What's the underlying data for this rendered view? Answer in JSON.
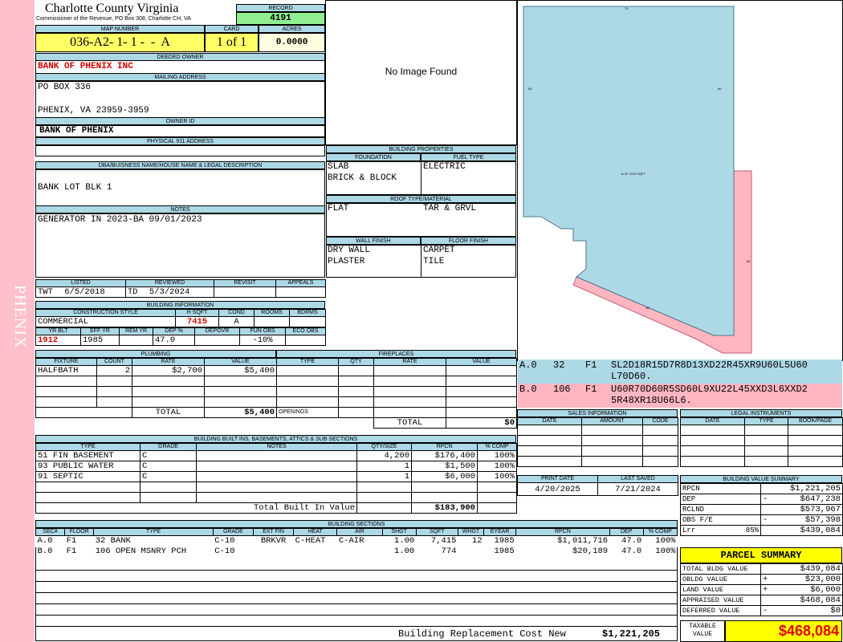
{
  "sidebar": {
    "label": "PHENIX",
    "color": "#ffc0cb"
  },
  "header": {
    "county": "Charlotte County Virginia",
    "commissioner": "Commissioner of the Revenue, PO Box 308, Charlotte CH, VA"
  },
  "record": {
    "label": "RECORD",
    "value": "4191"
  },
  "map_number": {
    "label": "MAP NUMBER",
    "value": "036-A2- 1- 1 -  -  A"
  },
  "card": {
    "label": "CARD",
    "value": "1 of 1"
  },
  "acres": {
    "label": "ACRES",
    "value": "0.0000"
  },
  "deeded_owner": {
    "label": "DEEDED OWNER",
    "value": "BANK OF PHENIX INC"
  },
  "mailing": {
    "label": "MAILING ADDRESS",
    "line1": "PO BOX 336",
    "line2": "PHENIX, VA 23959-3959"
  },
  "owner_id": {
    "label": "OWNER ID",
    "value": "BANK OF PHENIX"
  },
  "physical": {
    "label": "PHYSICAL 911 ADDRESS",
    "value": ""
  },
  "dba": {
    "label": "DBA/BUISNESS NAME/HOUSE NAME & LEGAL DESCRIPTION",
    "value": "BANK LOT BLK 1"
  },
  "notes": {
    "label": "NOTES",
    "value": "GENERATOR IN 2023-BA 09/01/2023"
  },
  "photo": {
    "text": "No Image Found"
  },
  "building_properties": {
    "label": "BUILDING PROPERTIES",
    "foundation_label": "FOUNDATION",
    "fuel_label": "FUEL TYPE",
    "foundation1": "SLAB",
    "foundation2": "BRICK & BLOCK",
    "fuel": "ELECTRIC",
    "roof_label": "ROOF TYPE/MATERIAL",
    "roof_type": "FLAT",
    "roof_material": "TAR & GRVL",
    "wall_label": "WALL FINISH",
    "floor_label": "FLOOR FINISH",
    "wall1": "DRY WALL",
    "wall2": "PLASTER",
    "floor1": "CARPET",
    "floor2": "TILE"
  },
  "review": {
    "listed_label": "LISTED",
    "reviewed_label": "REVIEWED",
    "revisit_label": "REVISIT",
    "appeals_label": "APPEALS",
    "listed_by": "TWT",
    "listed_date": "6/5/2018",
    "reviewed_by": "TD",
    "reviewed_date": "5/3/2024"
  },
  "building_info": {
    "label": "BUILDING INFORMATION",
    "style_label": "CONSTRUCTION STYLE",
    "hsqft_label": "H SQFT",
    "cond_label": "COND",
    "rooms_label": "ROOMS",
    "bdrms_label": "BDRMS",
    "style": "COMMERCIAL",
    "hsqft": "7415",
    "cond": "A",
    "yrblt_label": "YR BLT",
    "effyr_label": "EFF YR",
    "remyr_label": "REM YR",
    "dep_label": "DEP %",
    "depovr_label": "DEPOVR",
    "funobs_label": "FUN OBS",
    "ecoobs_label": "ECO OBS",
    "yrblt": "1912",
    "effyr": "1985",
    "dep": "47.0",
    "funobs": "-10%"
  },
  "plumbing": {
    "label": "PLUMBING",
    "cols": [
      "FIXTURE",
      "COUNT",
      "RATE",
      "VALUE"
    ],
    "rows": [
      [
        "HALFBATH",
        "2",
        "$2,700",
        "$5,400"
      ]
    ],
    "total_label": "TOTAL",
    "total": "$5,400"
  },
  "fireplaces": {
    "label": "FIREPLACES",
    "cols": [
      "TYPE",
      "QTY",
      "RATE",
      "VALUE"
    ],
    "openings_label": "OPENINGS",
    "total_label": "TOTAL",
    "total": "$0"
  },
  "sketch_legend": [
    {
      "code": "A.0",
      "num": "32",
      "floor": "F1",
      "line1": "SL2D18R15D7R8D13XD22R45XR9U60L5U60",
      "line2": "L70D60.",
      "color": "#add8e6"
    },
    {
      "code": "B.0",
      "num": "106",
      "floor": "F1",
      "line1": "U60R70D60R5SD60L9XU22L45XXD3L6XXD2",
      "line2": "5R48XR18U66L6.",
      "color": "#ffb6c1"
    }
  ],
  "sketch_labels": {
    "top": "70",
    "left": "60",
    "right": "60",
    "area": "A 32\n7415 SQFT",
    "b_right": "60",
    "b_bottom": "48"
  },
  "built_ins": {
    "label": "BUILDING BUILT INS, BASEMENTS, ATTICS & SUB SECTIONS",
    "cols": [
      "TYPE",
      "GRADE",
      "NOTES",
      "QTY/SIZE",
      "RPCN",
      "% COMP"
    ],
    "rows": [
      [
        "51 FIN BASEMENT",
        "C",
        "",
        "4,200",
        "$176,400",
        "100%"
      ],
      [
        "93 PUBLIC WATER",
        "C",
        "",
        "1",
        "$1,500",
        "100%"
      ],
      [
        "91 SEPTIC",
        "C",
        "",
        "1",
        "$6,000",
        "100%"
      ]
    ],
    "total_label": "Total Built In Value",
    "total": "$183,900"
  },
  "sales": {
    "label": "SALES INFORMATION",
    "cols": [
      "DATE",
      "AMOUNT",
      "CODE"
    ]
  },
  "legal": {
    "label": "LEGAL INSTRUMENTS",
    "cols": [
      "DATE",
      "TYPE",
      "BOOK/PAGE"
    ]
  },
  "print": {
    "print_label": "PRINT DATE",
    "saved_label": "LAST SAVED",
    "print_date": "4/20/2025",
    "saved_date": "7/21/2024"
  },
  "value_summary": {
    "label": "BUILDING VALUE SUMMARY",
    "rows": [
      {
        "k": "RPCN",
        "s": "",
        "v": "$1,221,205"
      },
      {
        "k": "DEP",
        "s": "-",
        "v": "$647,238"
      },
      {
        "k": "RCLND",
        "s": "",
        "v": "$573,967"
      },
      {
        "k": "OBS F/E",
        "s": "-",
        "v": "$57,398"
      },
      {
        "k": "Lrr",
        "p": "85%",
        "s": "",
        "v": "$439,084"
      }
    ]
  },
  "sections": {
    "label": "BUILDING SECTIONS",
    "cols": [
      "SEC#",
      "FLOOR",
      "TYPE",
      "GRADE",
      "EXT FIN",
      "HEAT",
      "AIR",
      "SHGT",
      "SQFT",
      "WHGT",
      "EYEAR",
      "RPCN",
      "DEP",
      "% COMP"
    ],
    "rows": [
      [
        "A.0",
        "F1",
        "32 BANK",
        "C-10",
        "BRKVR",
        "C-HEAT",
        "C-AIR",
        "1.00",
        "7,415",
        "12",
        "1985",
        "$1,011,716",
        "47.0",
        "100%"
      ],
      [
        "B.0",
        "F1",
        "106 OPEN MSNRY PCH",
        "C-10",
        "",
        "",
        "",
        "1.00",
        "774",
        "",
        "1985",
        "$20,189",
        "47.0",
        "100%"
      ]
    ],
    "total_label": "Building Replacement Cost New",
    "total": "$1,221,205"
  },
  "parcel_summary": {
    "label": "PARCEL SUMMARY",
    "rows": [
      {
        "k": "TOTAL BLDG VALUE",
        "s": "",
        "v": "$439,084"
      },
      {
        "k": "OBLDG VALUE",
        "s": "+",
        "v": "$23,000"
      },
      {
        "k": "LAND VALUE",
        "s": "+",
        "v": "$6,000"
      },
      {
        "k": "APPRAISED VALUE",
        "s": "",
        "v": "$468,084"
      },
      {
        "k": "DEFERRED VALUE",
        "s": "-",
        "v": "$0"
      }
    ],
    "taxable_label": "TAXABLE VALUE",
    "taxable": "$468,084"
  }
}
